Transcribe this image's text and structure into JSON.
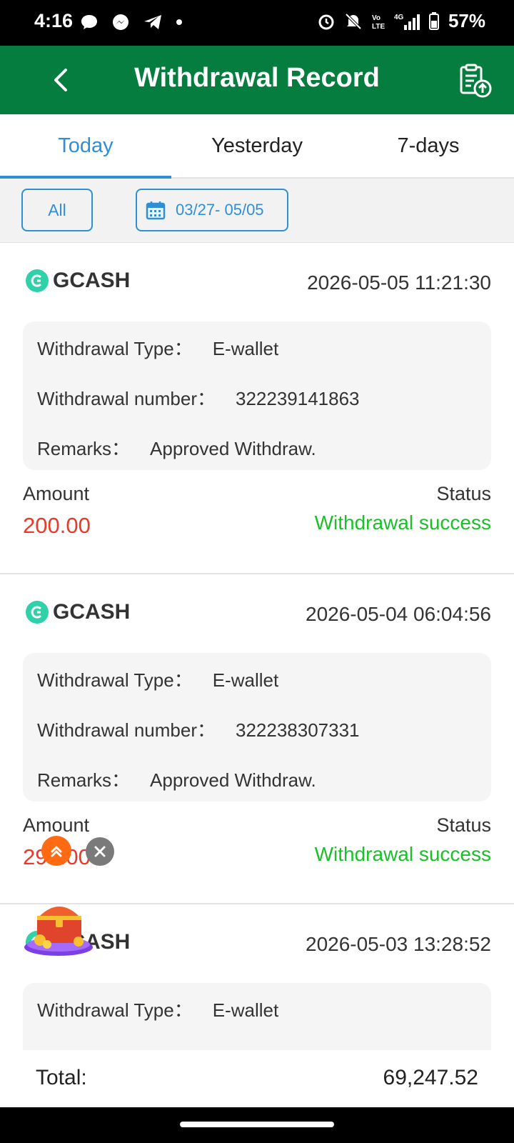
{
  "status_bar": {
    "time": "4:16",
    "battery": "57%",
    "network": "4G"
  },
  "header": {
    "title": "Withdrawal Record"
  },
  "tabs": [
    {
      "label": "Today",
      "active": true
    },
    {
      "label": "Yesterday",
      "active": false
    },
    {
      "label": "7-days",
      "active": false
    }
  ],
  "filters": {
    "all_label": "All",
    "date_range": "03/27- 05/05"
  },
  "labels": {
    "withdrawal_type": "Withdrawal Type：",
    "withdrawal_number": "Withdrawal number：",
    "remarks": "Remarks：",
    "amount": "Amount",
    "status": "Status"
  },
  "records": [
    {
      "provider": "GCASH",
      "datetime": "2026-05-05 11:21:30",
      "type": "E-wallet",
      "number": "322239141863",
      "remarks": "Approved Withdraw.",
      "amount": "200.00",
      "status": "Withdrawal success"
    },
    {
      "provider": "GCASH",
      "datetime": "2026-05-04 06:04:56",
      "type": "E-wallet",
      "number": "322238307331",
      "remarks": "Approved Withdraw.",
      "amount": "293.00",
      "status": "Withdrawal success"
    },
    {
      "provider": "GCASH",
      "datetime": "2026-05-03 13:28:52",
      "type": "E-wallet"
    }
  ],
  "footer": {
    "total_label": "Total:",
    "total_value": "69,247.52"
  },
  "colors": {
    "header_green": "#047d3e",
    "accent_blue": "#2f8fd6",
    "amount_red": "#e53b2c",
    "status_green": "#1bbf2a",
    "gcash_teal": "#2fd1a8"
  }
}
